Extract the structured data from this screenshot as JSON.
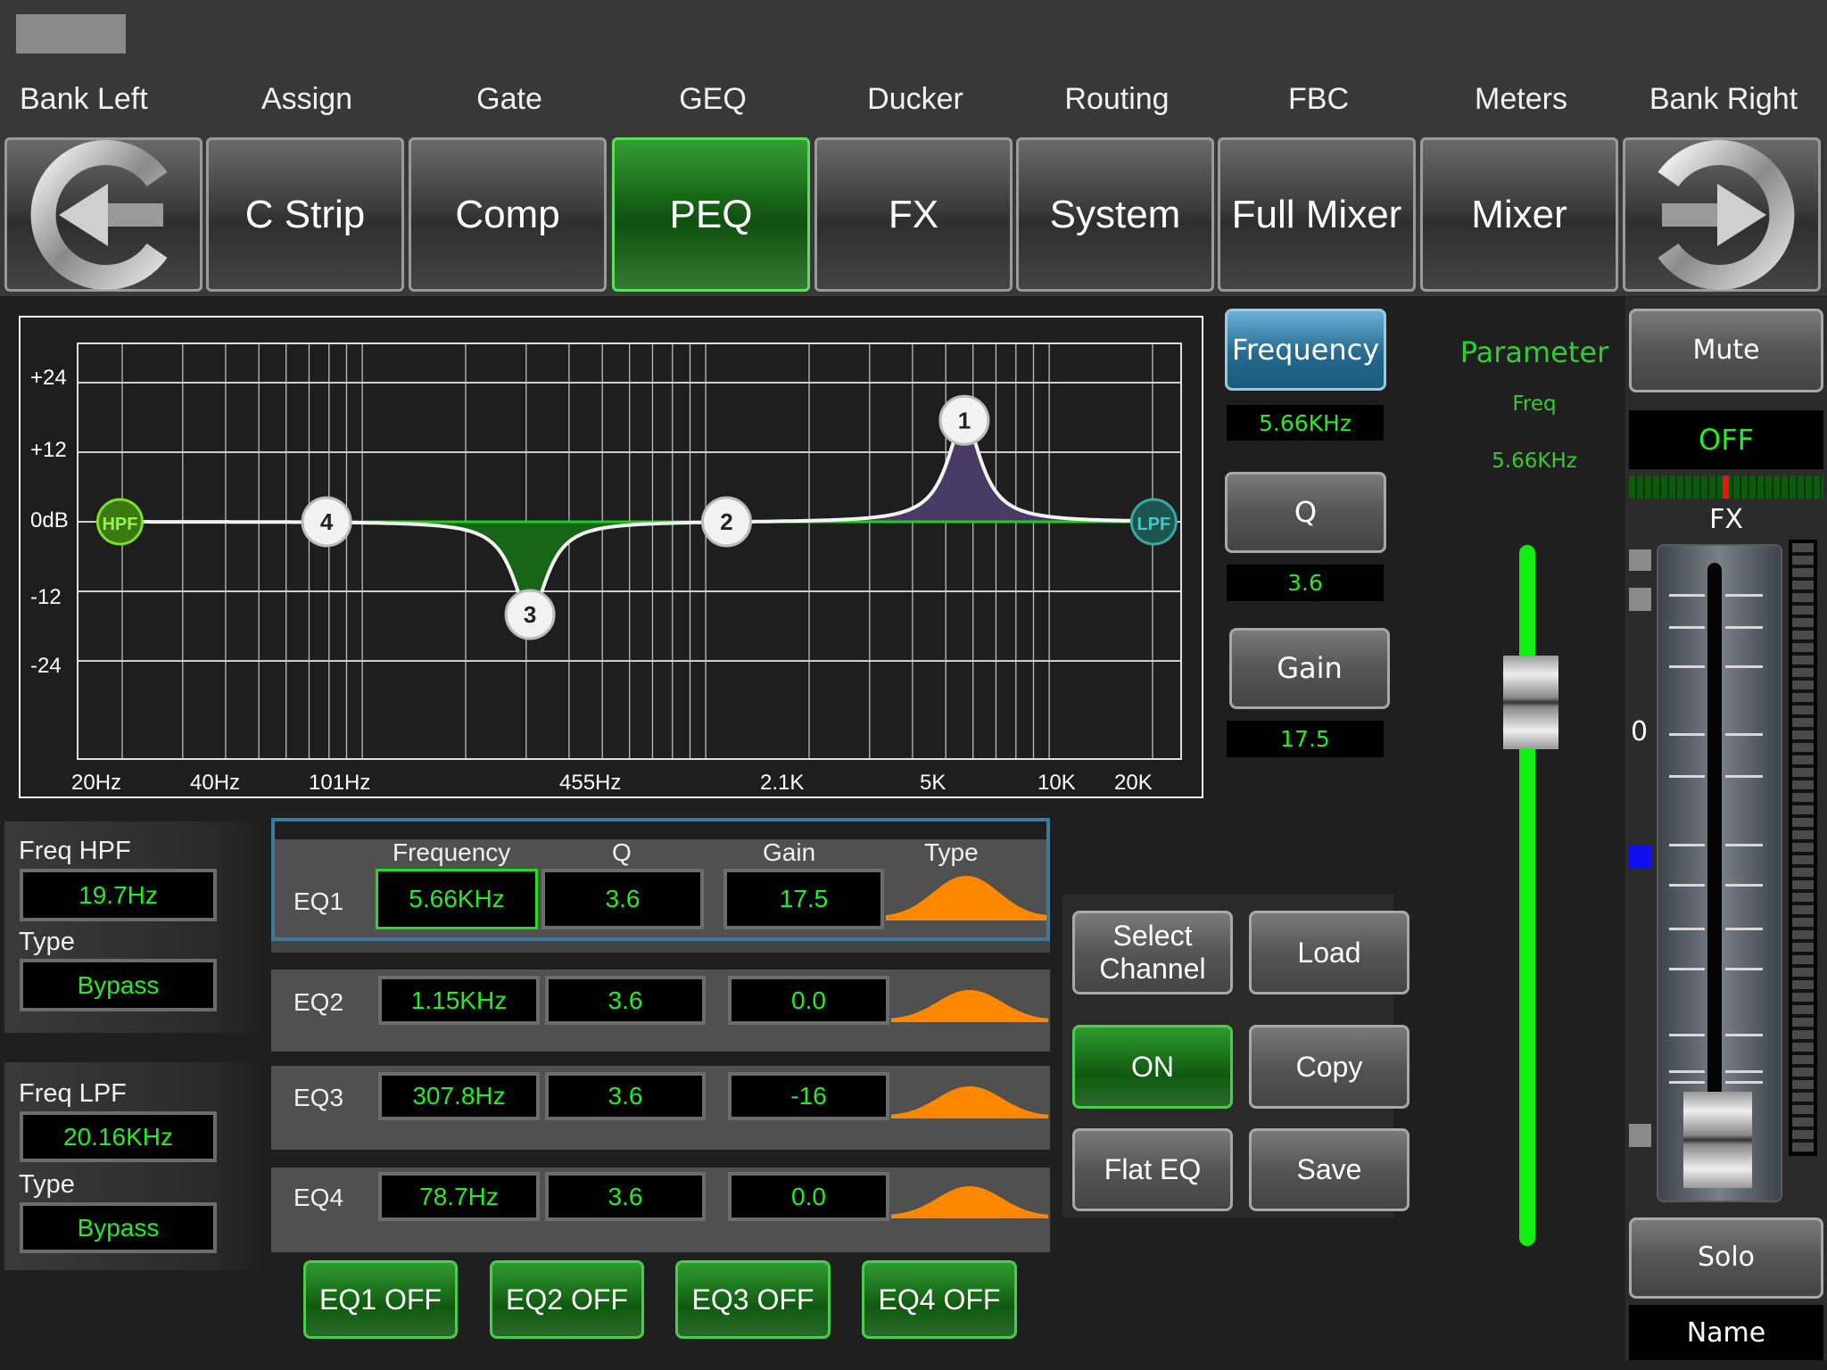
{
  "nav": {
    "labels": [
      "Bank Left",
      "Assign",
      "Gate",
      "GEQ",
      "Ducker",
      "Routing",
      "FBC",
      "Meters",
      "Bank Right"
    ],
    "buttons": [
      "",
      "C Strip",
      "Comp",
      "PEQ",
      "FX",
      "System",
      "Full Mixer",
      "Mixer",
      ""
    ],
    "active": "PEQ",
    "bank_left_icon": "arrow-left-circle-icon",
    "bank_right_icon": "arrow-right-circle-icon"
  },
  "eq_graph": {
    "y_ticks": [
      "+24",
      "+12",
      "0dB",
      "-12",
      "-24"
    ],
    "x_ticks": [
      "20Hz",
      "40Hz",
      "101Hz",
      "455Hz",
      "2.1K",
      "5K",
      "10K",
      "20K"
    ],
    "hpf": {
      "label": "HPF",
      "freq_hz": 19.7
    },
    "lpf": {
      "label": "LPF",
      "freq_hz": 20160
    },
    "bands": [
      {
        "id": "1",
        "freq_hz": 5660,
        "q": 3.6,
        "gain_db": 17.5
      },
      {
        "id": "2",
        "freq_hz": 1150,
        "q": 3.6,
        "gain_db": 0.0
      },
      {
        "id": "3",
        "freq_hz": 307.8,
        "q": 3.6,
        "gain_db": -16
      },
      {
        "id": "4",
        "freq_hz": 78.7,
        "q": 3.6,
        "gain_db": 0.0
      }
    ],
    "colors": {
      "boost_fill": "#4a3a66",
      "cut_fill": "#176617",
      "curve": "#f4f4f4",
      "baseline": "#22cc22"
    }
  },
  "params": {
    "frequency_label": "Frequency",
    "frequency_value": "5.66KHz",
    "q_label": "Q",
    "q_value": "3.6",
    "gain_label": "Gain",
    "gain_value": "17.5",
    "title": "Parameter",
    "sub": "Freq",
    "sub_value": "5.66KHz"
  },
  "filters": {
    "hpf_label": "Freq HPF",
    "hpf_value": "19.7Hz",
    "hpf_type_label": "Type",
    "hpf_type": "Bypass",
    "lpf_label": "Freq LPF",
    "lpf_value": "20.16KHz",
    "lpf_type_label": "Type",
    "lpf_type": "Bypass"
  },
  "eq_table": {
    "headers": {
      "frequency": "Frequency",
      "q": "Q",
      "gain": "Gain",
      "type": "Type"
    },
    "rows": [
      {
        "name": "EQ1",
        "freq": "5.66KHz",
        "q": "3.6",
        "gain": "17.5",
        "type": "bell-icon"
      },
      {
        "name": "EQ2",
        "freq": "1.15KHz",
        "q": "3.6",
        "gain": "0.0",
        "type": "bell-icon"
      },
      {
        "name": "EQ3",
        "freq": "307.8Hz",
        "q": "3.6",
        "gain": "-16",
        "type": "bell-icon"
      },
      {
        "name": "EQ4",
        "freq": "78.7Hz",
        "q": "3.6",
        "gain": "0.0",
        "type": "bell-icon"
      }
    ],
    "selected": "EQ1",
    "off_buttons": [
      "EQ1 OFF",
      "EQ2 OFF",
      "EQ3 OFF",
      "EQ4 OFF"
    ]
  },
  "actions": {
    "select_channel": "Select Channel",
    "load": "Load",
    "on": "ON",
    "copy": "Copy",
    "flat_eq": "Flat EQ",
    "save": "Save"
  },
  "channel": {
    "mute": "Mute",
    "mute_state": "OFF",
    "name": "FX",
    "zero_mark": "0",
    "solo": "Solo",
    "name_label": "Name"
  }
}
